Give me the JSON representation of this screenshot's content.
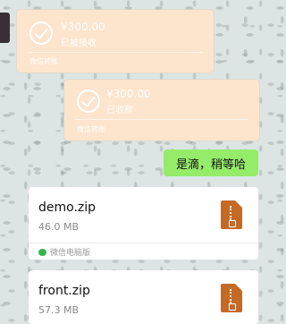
{
  "colors": {
    "transfer_bg": "#fde4cc",
    "sent_bubble": "#95ec69",
    "file_icon": "#c46a26",
    "wechat_green": "#35b64a"
  },
  "transfers": [
    {
      "amount": "¥300.00",
      "status": "已被接收",
      "footer": "微信转账"
    },
    {
      "amount": "¥300.00",
      "status": "已收款",
      "footer": "微信转账"
    }
  ],
  "message": {
    "text": "是滴，稍等哈"
  },
  "files": [
    {
      "name": "demo.zip",
      "size": "46.0 MB",
      "source": "微信电脑版",
      "icon": "zip-file-icon"
    },
    {
      "name": "front.zip",
      "size": "57.3 MB",
      "icon": "zip-file-icon"
    }
  ]
}
